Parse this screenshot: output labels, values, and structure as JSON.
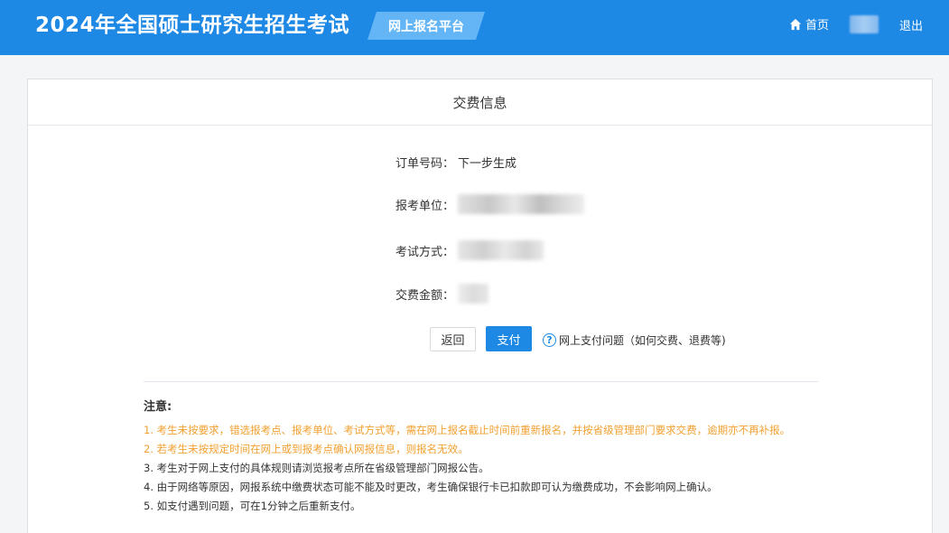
{
  "header": {
    "site_title": "2024年全国硕士研究生招生考试",
    "platform_tag": "网上报名平台",
    "home_label": "首页",
    "logout_label": "退出"
  },
  "panel": {
    "title": "交费信息"
  },
  "fields": {
    "order_label": "订单号码：",
    "order_value": "下一步生成",
    "unit_label": "报考单位：",
    "method_label": "考试方式：",
    "fee_label": "交费金额："
  },
  "actions": {
    "back_label": "返回",
    "pay_label": "支付",
    "help_icon": "?",
    "help_label": "网上支付问题（如何交费、退费等)"
  },
  "notice": {
    "title": "注意:",
    "items": [
      "1. 考生未按要求，错选报考点、报考单位、考试方式等，需在网上报名截止时间前重新报名，并按省级管理部门要求交费，逾期亦不再补报。",
      "2. 若考生未按规定时间在网上或到报考点确认网报信息，则报名无效。",
      "3. 考生对于网上支付的具体规则请浏览报考点所在省级管理部门网报公告。",
      "4. 由于网络等原因，网报系统中缴费状态可能不能及时更改，考生确保银行卡已扣款即可认为缴费成功，不会影响网上确认。",
      "5. 如支付遇到问题，可在1分钟之后重新支付。"
    ]
  },
  "colors": {
    "primary": "#1e88e5",
    "warning": "#f0a030",
    "tag": "#64b5f6"
  }
}
